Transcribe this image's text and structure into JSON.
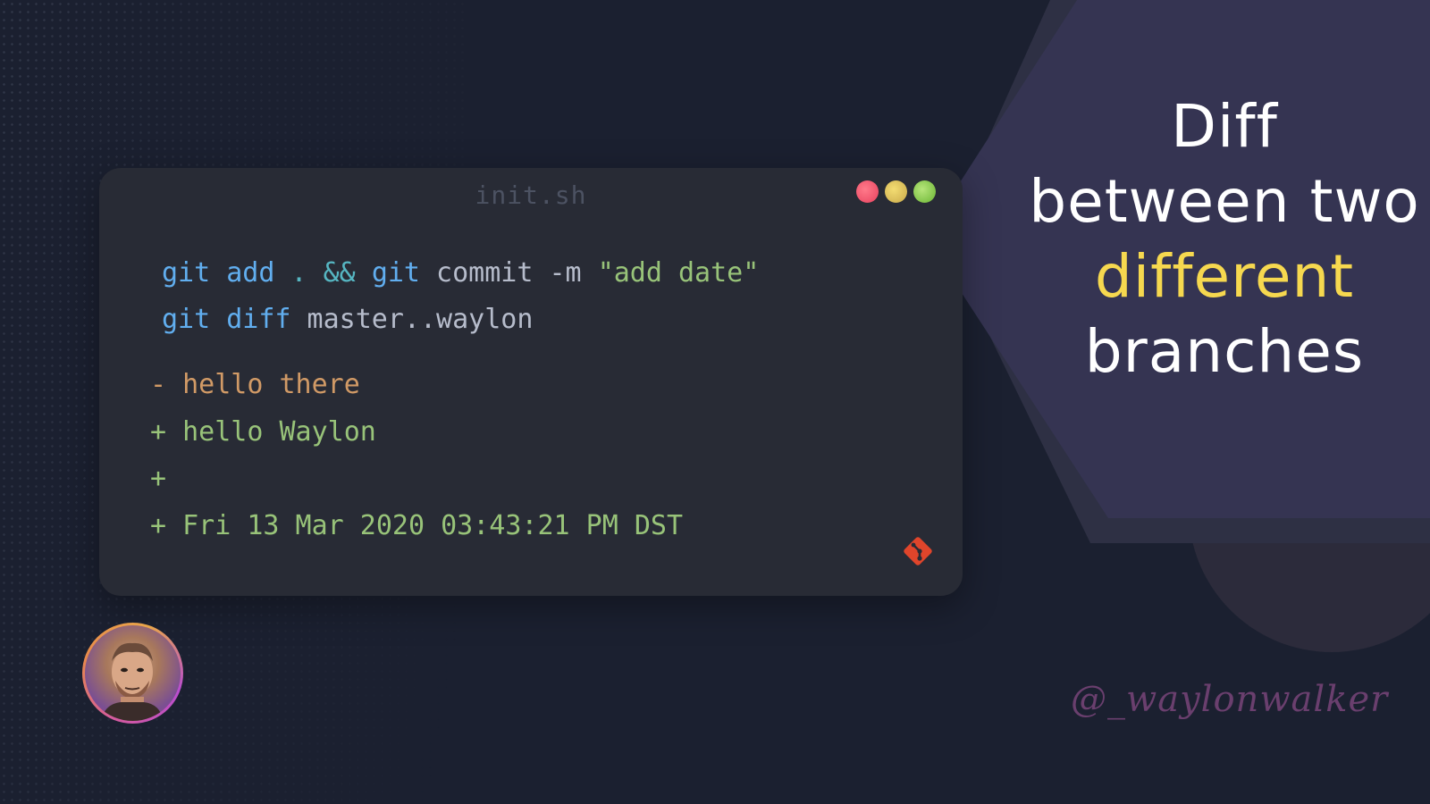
{
  "window": {
    "filename": "init.sh",
    "commands": [
      [
        {
          "text": "git",
          "kind": "cmd"
        },
        {
          "text": " ",
          "kind": "plain"
        },
        {
          "text": "add",
          "kind": "cmd"
        },
        {
          "text": " ",
          "kind": "plain"
        },
        {
          "text": ".",
          "kind": "op"
        },
        {
          "text": " ",
          "kind": "plain"
        },
        {
          "text": "&&",
          "kind": "op"
        },
        {
          "text": " ",
          "kind": "plain"
        },
        {
          "text": "git",
          "kind": "cmd"
        },
        {
          "text": " commit -m ",
          "kind": "plain"
        },
        {
          "text": "\"add date\"",
          "kind": "str"
        }
      ],
      [
        {
          "text": "git",
          "kind": "cmd"
        },
        {
          "text": " ",
          "kind": "plain"
        },
        {
          "text": "diff",
          "kind": "cmd"
        },
        {
          "text": " master..waylon",
          "kind": "plain"
        }
      ]
    ],
    "diff_lines": [
      {
        "text": "- hello there",
        "kind": "removed"
      },
      {
        "text": "+ hello Waylon",
        "kind": "added"
      },
      {
        "text": "+",
        "kind": "added"
      },
      {
        "text": "+ Fri 13 Mar 2020 03:43:21 PM DST",
        "kind": "added"
      }
    ],
    "window_buttons": [
      "close",
      "minimize",
      "maximize"
    ],
    "logo_icon": "git-icon"
  },
  "title": {
    "line1": "Diff",
    "line2": "between two",
    "line3": "different",
    "line4": "branches"
  },
  "handle": "@_waylonwalker",
  "avatar": {
    "icon": "avatar"
  },
  "colors": {
    "background": "#1b2030",
    "panel": "#353452",
    "window": "#282b35",
    "accent": "#f6d84f",
    "handle": "#6a3f6e",
    "git_logo": "#e0452b"
  }
}
